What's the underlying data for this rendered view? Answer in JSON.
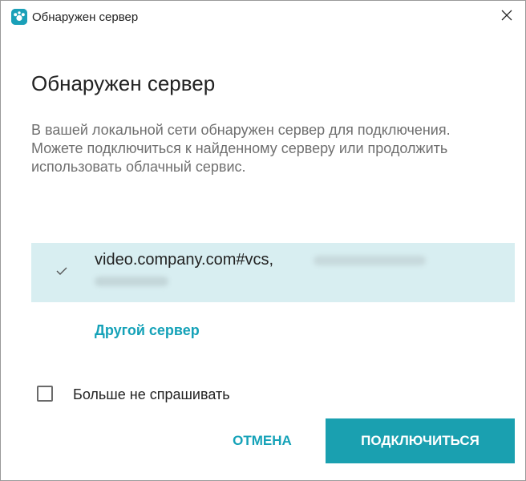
{
  "window": {
    "title": "Обнаружен сервер",
    "app_icon": "app-logo-icon",
    "close_icon": "close-icon"
  },
  "dialog": {
    "heading": "Обнаружен сервер",
    "description": "В вашей локальной сети обнаружен сервер для подключения. Можете подключиться к найденному серверу или продолжить использовать облачный сервис."
  },
  "server_list": [
    {
      "name": "video.company.com#vcs,",
      "selected": true,
      "icon": "check-icon"
    }
  ],
  "other_server_link": "Другой сервер",
  "dont_ask": {
    "label": "Больше не спрашивать",
    "checked": false
  },
  "buttons": {
    "cancel": "ОТМЕНА",
    "connect": "ПОДКЛЮЧИТЬСЯ"
  },
  "colors": {
    "accent": "#15a2b8",
    "primary_button": "#1aa0b0",
    "selected_row": "#d8eef1",
    "description_text": "#6f6f6f"
  }
}
